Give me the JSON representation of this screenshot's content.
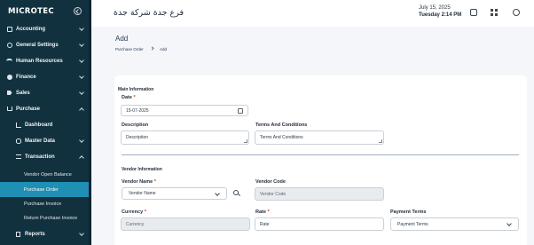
{
  "app": {
    "logo_text": "MICROTEC"
  },
  "header": {
    "company_name": "فرع جدة شركة جدة",
    "date": "July 15, 2025",
    "day_time": "Tuesday  2:14 PM",
    "icons": [
      "frame-icon",
      "grid-icon",
      "user-icon"
    ]
  },
  "sidebar": {
    "items": [
      {
        "label": "Accounting",
        "icon": "book-icon"
      },
      {
        "label": "General Settings",
        "icon": "gear-icon"
      },
      {
        "label": "Human Resources",
        "icon": "people-icon"
      },
      {
        "label": "Finance",
        "icon": "coin-icon"
      },
      {
        "label": "Sales",
        "icon": "tag-icon"
      },
      {
        "label": "Purchase",
        "icon": "cart-icon"
      },
      {
        "label": "Dashboard",
        "icon": "chart-icon"
      },
      {
        "label": "Master Data",
        "icon": "database-icon"
      },
      {
        "label": "Transaction",
        "icon": "swap-icon"
      },
      {
        "label": "Vendor Open Balance"
      },
      {
        "label": "Purchase Order"
      },
      {
        "label": "Purchase Invoice"
      },
      {
        "label": "Return Purchase Invoice"
      },
      {
        "label": "Reports",
        "icon": "report-icon"
      }
    ],
    "active_item": "Purchase Order"
  },
  "page": {
    "title": "Add",
    "breadcrumb": [
      "Purchase Order",
      "Add"
    ]
  },
  "form": {
    "main_section_title": "Main Information",
    "date_label": "Date",
    "date_value": "15-07-2025",
    "description_label": "Description",
    "description_value": "Description",
    "terms_label": "Terms And Conditions",
    "terms_value": "Terms And Conditions",
    "vendor_section_title": "Vendor Information",
    "vendor_name_label": "Vendor Name",
    "vendor_name_value": "Vendor Name",
    "vendor_code_label": "Vendor Code",
    "vendor_code_value": "Vendor Code",
    "currency_label": "Currency",
    "currency_value": "Currency",
    "rate_label": "Rate",
    "rate_value": "Rate",
    "payment_terms_label": "Payment Terms",
    "payment_terms_value": "Payment Terms",
    "required_mark": "*"
  },
  "colors": {
    "sidebar_bg": "#12313f",
    "active_item": "#1f8fb3",
    "required": "#d92d20"
  }
}
